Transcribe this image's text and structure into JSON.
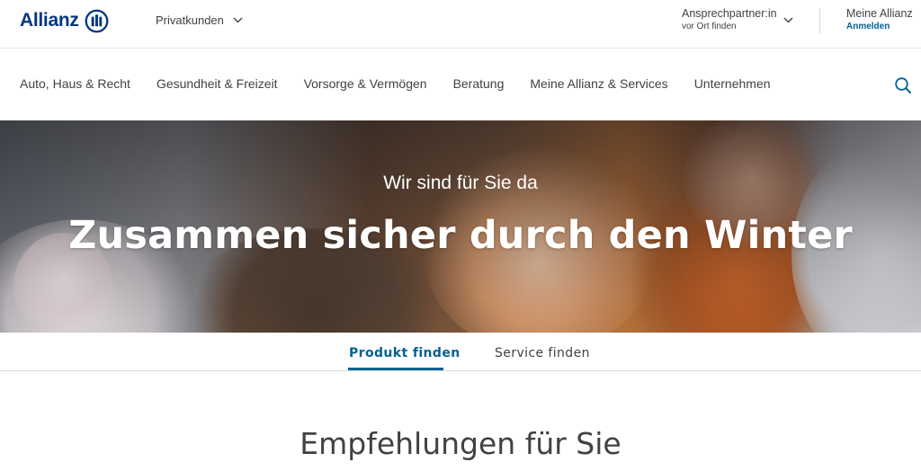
{
  "brand": {
    "logo_text": "Allianz",
    "color": "#003781"
  },
  "topbar": {
    "segment_label": "Privatkunden",
    "contact_title": "Ansprechpartner:in",
    "contact_sub": "vor Ort finden",
    "account_title": "Meine Allianz",
    "account_login": "Anmelden"
  },
  "nav": {
    "items": [
      {
        "label": "Auto, Haus & Recht"
      },
      {
        "label": "Gesundheit & Freizeit"
      },
      {
        "label": "Vorsorge & Vermögen"
      },
      {
        "label": "Beratung"
      },
      {
        "label": "Meine Allianz & Services"
      },
      {
        "label": "Unternehmen"
      }
    ],
    "search_icon": "search-icon"
  },
  "hero": {
    "kicker": "Wir sind für Sie da",
    "title": "Zusammen sicher durch den Winter"
  },
  "tabs": [
    {
      "label": "Produkt finden",
      "active": true
    },
    {
      "label": "Service finden",
      "active": false
    }
  ],
  "recommendations": {
    "title": "Empfehlungen für Sie"
  },
  "colors": {
    "accent": "#006192",
    "text": "#414141"
  }
}
